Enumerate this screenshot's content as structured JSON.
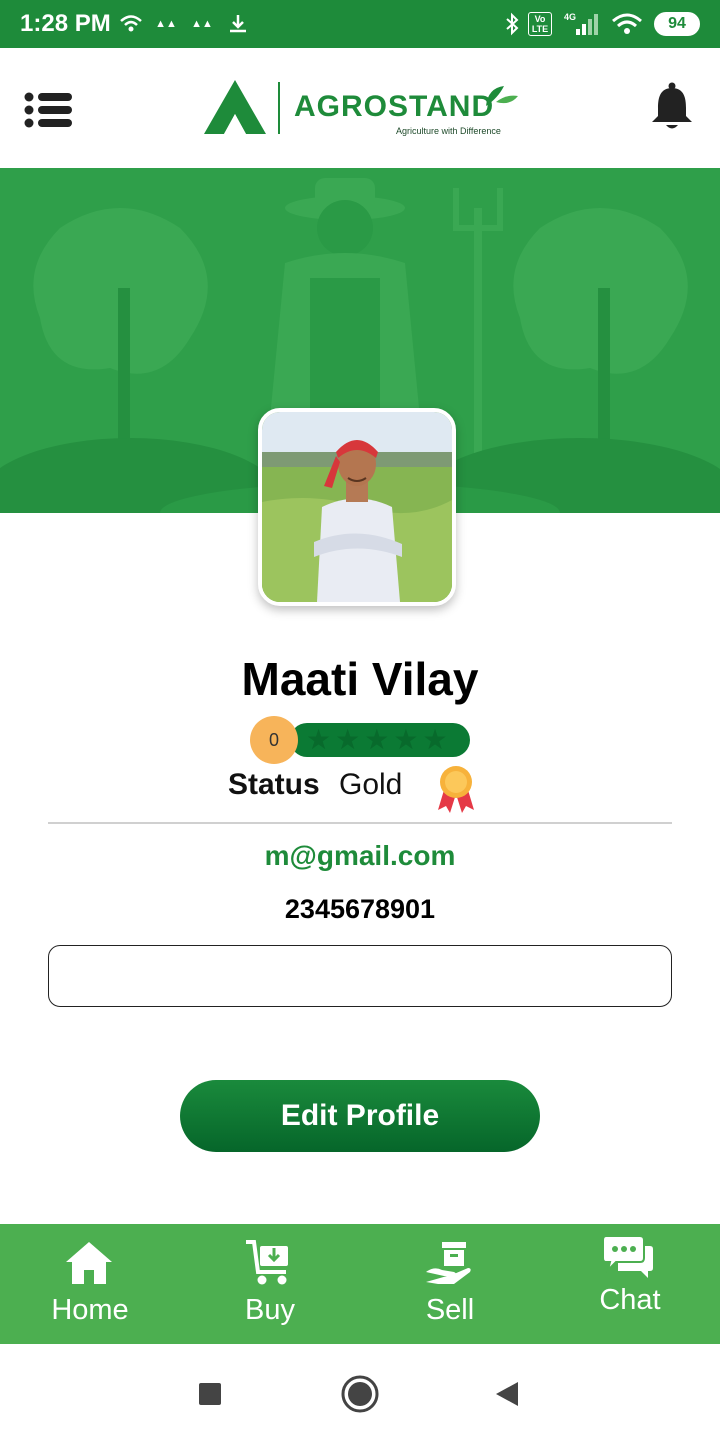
{
  "status_bar": {
    "time": "1:28 PM",
    "battery": "94",
    "network": "4G",
    "volte": "Vo LTE"
  },
  "header": {
    "brand_name": "AGROSTAND",
    "brand_tagline": "Agriculture with Difference"
  },
  "profile": {
    "name": "Maati Vilay",
    "rating_count": "0",
    "stars_total": 5,
    "status_label": "Status",
    "status_value": "Gold",
    "email": "m@gmail.com",
    "phone": "2345678901",
    "address_value": ""
  },
  "actions": {
    "edit_profile": "Edit Profile"
  },
  "bottom_nav": {
    "items": [
      {
        "label": "Home",
        "icon": "home-icon"
      },
      {
        "label": "Buy",
        "icon": "cart-icon"
      },
      {
        "label": "Sell",
        "icon": "sell-hand-box-icon"
      },
      {
        "label": "Chat",
        "icon": "chat-icon"
      }
    ]
  },
  "colors": {
    "primary": "#1e8b3a",
    "nav_green": "#4caf50",
    "banner_green": "#2f9f4a",
    "rating_badge": "#f7b45a"
  }
}
